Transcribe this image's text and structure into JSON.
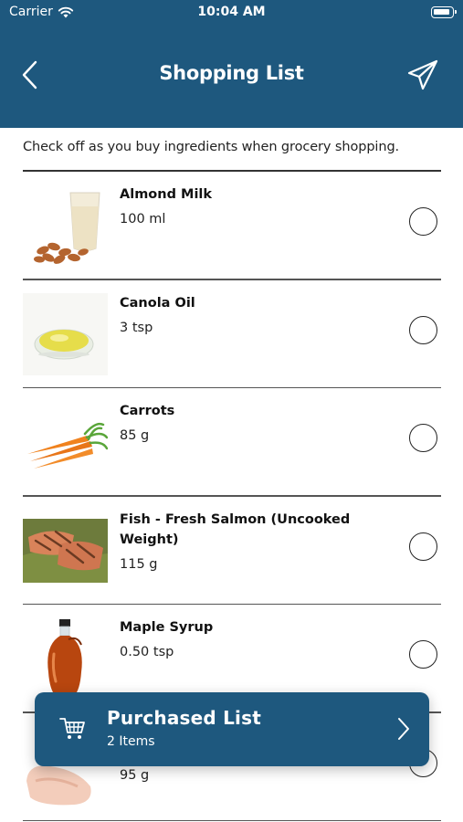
{
  "status_bar": {
    "carrier": "Carrier",
    "time": "10:04 AM"
  },
  "nav": {
    "back_icon": "chevron-left-icon",
    "title": "Shopping List",
    "send_icon": "paper-plane-icon"
  },
  "instructions": "Check off as you buy ingredients when grocery shopping.",
  "items": [
    {
      "name": "Almond Milk",
      "quantity": "100 ml",
      "checked": false
    },
    {
      "name": "Canola Oil",
      "quantity": "3 tsp",
      "checked": false
    },
    {
      "name": "Carrots",
      "quantity": "85 g",
      "checked": false
    },
    {
      "name": "Fish - Fresh Salmon (Uncooked Weight)",
      "quantity": "115 g",
      "checked": false
    },
    {
      "name": "Maple Syrup",
      "quantity": "0.50 tsp",
      "checked": false
    },
    {
      "name": "",
      "quantity": "95 g",
      "checked": false
    }
  ],
  "purchased": {
    "icon": "cart-icon",
    "title": "Purchased List",
    "count_label": "2 Items"
  },
  "colors": {
    "brand": "#1e587e",
    "background": "#ffffff"
  }
}
